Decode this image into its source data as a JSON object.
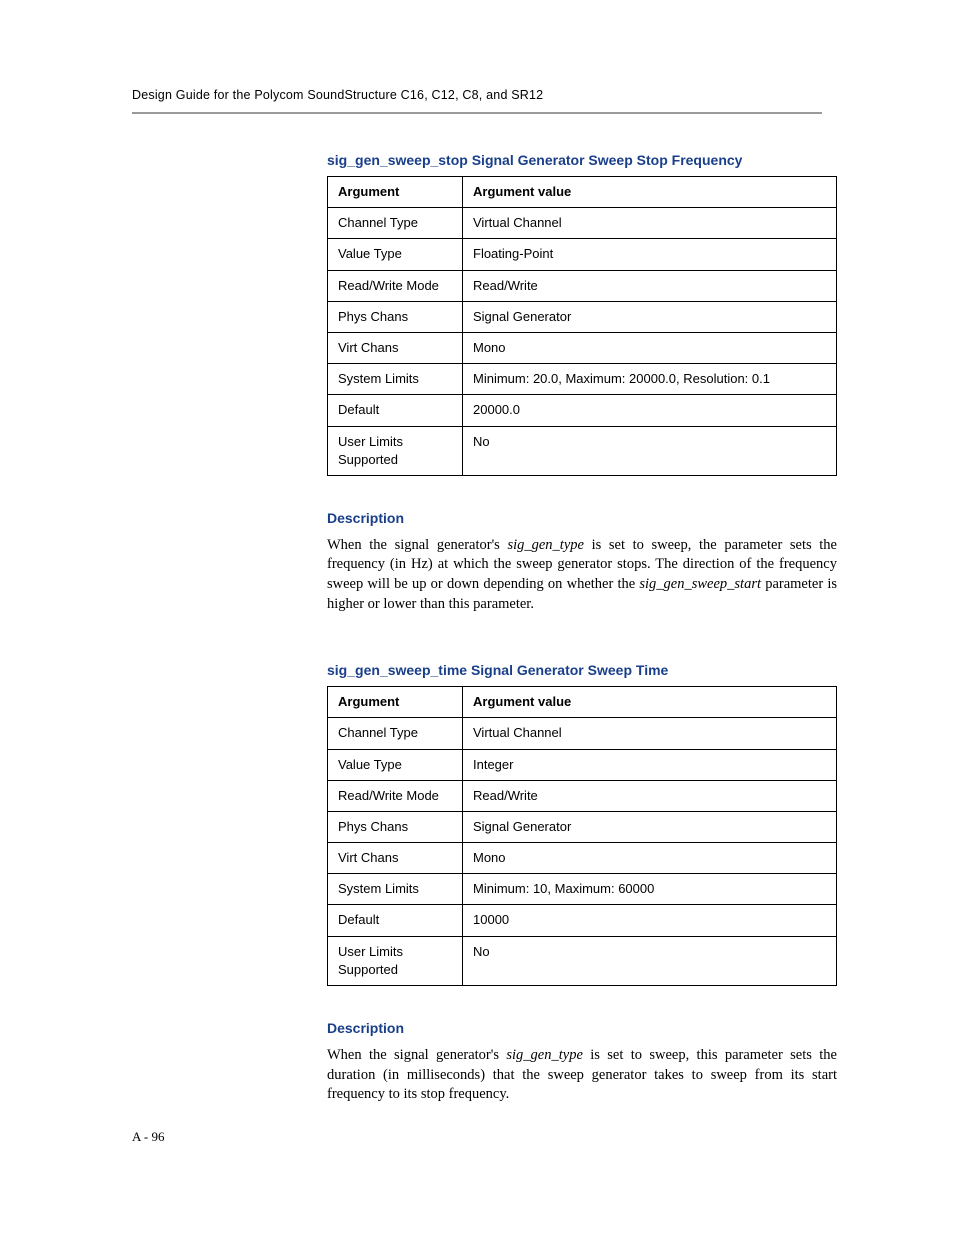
{
  "header": {
    "running": "Design Guide for the Polycom SoundStructure C16, C12, C8, and SR12"
  },
  "sections": [
    {
      "title": "sig_gen_sweep_stop Signal Generator Sweep Stop Frequency",
      "table": {
        "head": {
          "arg": "Argument",
          "val": "Argument value"
        },
        "rows": [
          {
            "arg": "Channel Type",
            "val": "Virtual Channel"
          },
          {
            "arg": "Value Type",
            "val": "Floating-Point"
          },
          {
            "arg": "Read/Write Mode",
            "val": "Read/Write"
          },
          {
            "arg": "Phys Chans",
            "val": "Signal Generator"
          },
          {
            "arg": "Virt Chans",
            "val": "Mono"
          },
          {
            "arg": "System Limits",
            "val": "Minimum: 20.0, Maximum: 20000.0, Resolution: 0.1"
          },
          {
            "arg": "Default",
            "val": "20000.0"
          },
          {
            "arg": "User Limits Supported",
            "val": "No"
          }
        ]
      },
      "desc_heading": "Description",
      "desc_parts": {
        "p1a": "When the signal generator's ",
        "p1b": "sig_gen_type",
        "p1c": " is set to sweep, the parameter sets the frequency (in Hz) at which the sweep generator stops. The direction of the frequency sweep will be up or down depending on whether the ",
        "p1d": "sig_gen_sweep_start",
        "p1e": " parameter is higher or lower than this parameter."
      }
    },
    {
      "title": "sig_gen_sweep_time Signal Generator Sweep Time",
      "table": {
        "head": {
          "arg": "Argument",
          "val": "Argument value"
        },
        "rows": [
          {
            "arg": "Channel Type",
            "val": "Virtual Channel"
          },
          {
            "arg": "Value Type",
            "val": "Integer"
          },
          {
            "arg": "Read/Write Mode",
            "val": "Read/Write"
          },
          {
            "arg": "Phys Chans",
            "val": "Signal Generator"
          },
          {
            "arg": "Virt Chans",
            "val": "Mono"
          },
          {
            "arg": "System Limits",
            "val": "Minimum: 10, Maximum: 60000"
          },
          {
            "arg": "Default",
            "val": "10000"
          },
          {
            "arg": "User Limits Supported",
            "val": "No"
          }
        ]
      },
      "desc_heading": "Description",
      "desc_parts": {
        "p1a": "When the signal generator's ",
        "p1b": "sig_gen_type",
        "p1c": " is set to sweep, this parameter sets the duration (in milliseconds) that the sweep generator takes to sweep from its start frequency to its stop frequency."
      }
    }
  ],
  "footer": {
    "page": "A - 96"
  }
}
